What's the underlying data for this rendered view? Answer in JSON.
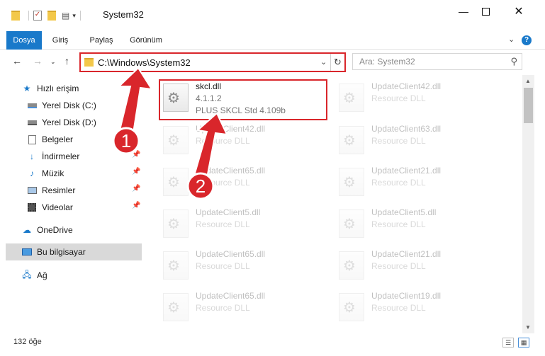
{
  "window": {
    "title": "System32"
  },
  "ribbon": {
    "tabs": [
      {
        "label": "Dosya",
        "active": true
      },
      {
        "label": "Giriş",
        "active": false
      },
      {
        "label": "Paylaş",
        "active": false
      },
      {
        "label": "Görünüm",
        "active": false
      }
    ]
  },
  "address": {
    "path": "C:\\Windows\\System32"
  },
  "search": {
    "placeholder": "Ara: System32"
  },
  "sidebar": {
    "items": [
      {
        "label": "Hızlı erişim",
        "icon": "star-icon",
        "pinned": false
      },
      {
        "label": "Yerel Disk (C:)",
        "icon": "drive-icon",
        "pinned": false
      },
      {
        "label": "Yerel Disk (D:)",
        "icon": "drive-icon",
        "pinned": false
      },
      {
        "label": "Belgeler",
        "icon": "documents-icon",
        "pinned": false
      },
      {
        "label": "İndirmeler",
        "icon": "download-icon",
        "pinned": true
      },
      {
        "label": "Müzik",
        "icon": "music-icon",
        "pinned": true
      },
      {
        "label": "Resimler",
        "icon": "pictures-icon",
        "pinned": true
      },
      {
        "label": "Videolar",
        "icon": "video-icon",
        "pinned": true
      },
      {
        "label": "OneDrive",
        "icon": "cloud-icon",
        "pinned": false
      },
      {
        "label": "Bu bilgisayar",
        "icon": "computer-icon",
        "pinned": false,
        "selected": true
      },
      {
        "label": "Ağ",
        "icon": "network-icon",
        "pinned": false
      }
    ]
  },
  "files": {
    "left": [
      {
        "name": "skcl.dll",
        "line2": "4.1.1.2",
        "line3": "PLUS SKCL Std 4.109b",
        "highlighted": true
      },
      {
        "name": "UpdateClient42.dll",
        "line2": "Resource DLL"
      },
      {
        "name": "UpdateClient65.dll",
        "line2": "Resource DLL"
      },
      {
        "name": "UpdateClient5.dll",
        "line2": "Resource DLL"
      },
      {
        "name": "UpdateClient65.dll",
        "line2": "Resource DLL"
      },
      {
        "name": "UpdateClient65.dll",
        "line2": "Resource DLL"
      }
    ],
    "right": [
      {
        "name": "UpdateClient42.dll",
        "line2": "Resource DLL"
      },
      {
        "name": "UpdateClient63.dll",
        "line2": "Resource DLL"
      },
      {
        "name": "UpdateClient21.dll",
        "line2": "Resource DLL"
      },
      {
        "name": "UpdateClient5.dll",
        "line2": "Resource DLL"
      },
      {
        "name": "UpdateClient21.dll",
        "line2": "Resource DLL"
      },
      {
        "name": "UpdateClient19.dll",
        "line2": "Resource DLL"
      }
    ]
  },
  "callouts": {
    "one": "1",
    "two": "2"
  },
  "status": {
    "count": "132 öğe"
  },
  "colors": {
    "accent": "#1979ca",
    "annotation": "#d9262b"
  }
}
